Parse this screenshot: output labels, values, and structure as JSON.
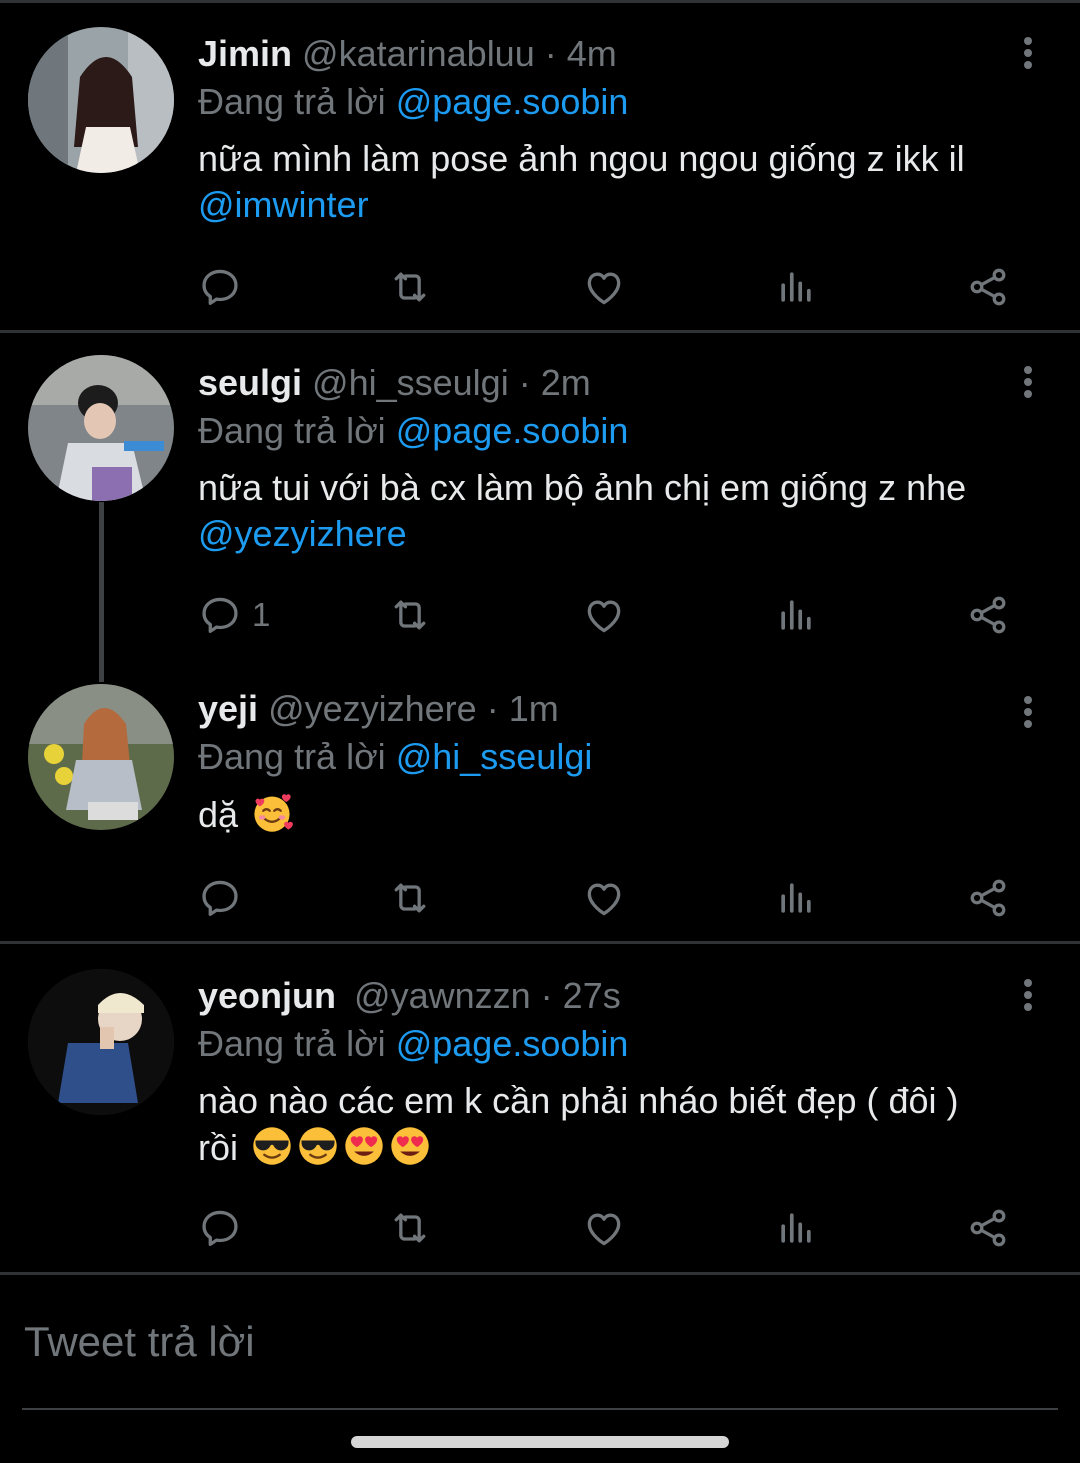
{
  "reply_prefix": "Đang trả lời",
  "tweets": [
    {
      "name": "Jimin",
      "handle": "@katarinabluu",
      "time": "4m",
      "reply_to": "@page.soobin",
      "text": "nữa mình làm pose ảnh ngou ngou giống z ikk il",
      "text_mention": "@imwinter",
      "reply_count": ""
    },
    {
      "name": "seulgi",
      "handle": "@hi_sseulgi",
      "time": "2m",
      "reply_to": "@page.soobin",
      "text": "nữa tui với bà cx làm bộ ảnh chị em giống z nhe",
      "text_mention": "@yezyizhere",
      "reply_count": "1"
    },
    {
      "name": "yeji",
      "handle": "@yezyizhere",
      "time": "1m",
      "reply_to": "@hi_sseulgi",
      "text": "dặ",
      "emojis": [
        "smiling-face-with-hearts"
      ],
      "reply_count": ""
    },
    {
      "name": "yeonjun",
      "handle": "@yawnzzn",
      "time": "27s",
      "reply_to": "@page.soobin",
      "text": "nào nào các em k cần phải nháo biết đẹp ( đôi )",
      "text_line2": "rồi",
      "emojis": [
        "sunglasses-face",
        "sunglasses-face",
        "heart-eyes-face",
        "heart-eyes-face"
      ],
      "reply_count": ""
    }
  ],
  "separator": "·",
  "reply_input_placeholder": "Tweet trả lời",
  "colors": {
    "background": "#000000",
    "text": "#e7e9ea",
    "secondary": "#71767b",
    "accent": "#1d9bf0",
    "divider": "#2f3336"
  }
}
